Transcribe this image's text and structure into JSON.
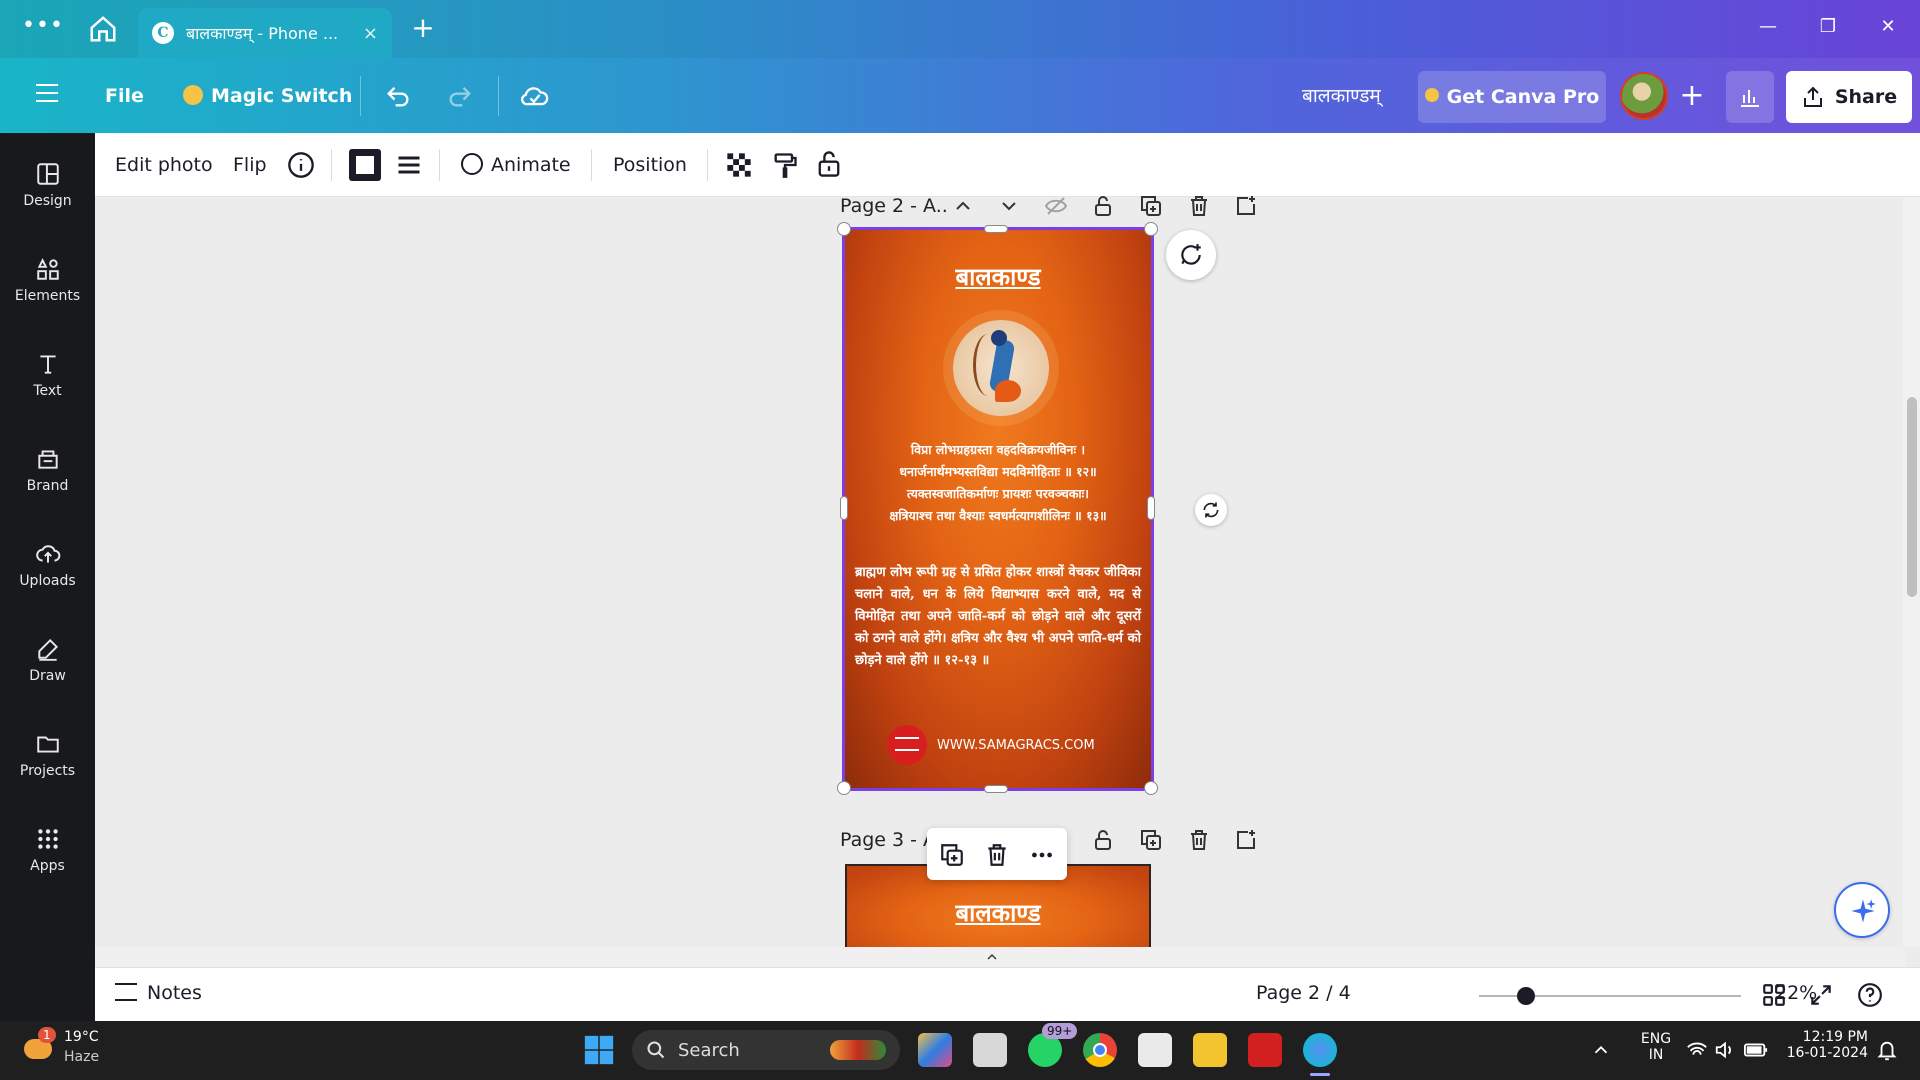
{
  "browser": {
    "tab_title": "बालकाण्डम् - Phone ...",
    "tab_logo": "C",
    "tab_close": "×",
    "new_tab": "+",
    "menu_dots": "•••",
    "window_minimize": "—",
    "window_restore": "❐",
    "window_close": "✕"
  },
  "header": {
    "file_label": "File",
    "magic_switch_label": "Magic Switch",
    "design_title": "बालकाण्डम्",
    "get_pro_label": "Get Canva Pro",
    "add_label": "+",
    "share_label": "Share"
  },
  "sidebar": {
    "items": [
      {
        "label": "Design"
      },
      {
        "label": "Elements"
      },
      {
        "label": "Text"
      },
      {
        "label": "Brand"
      },
      {
        "label": "Uploads"
      },
      {
        "label": "Draw"
      },
      {
        "label": "Projects"
      },
      {
        "label": "Apps"
      }
    ]
  },
  "toolbar": {
    "edit_photo": "Edit photo",
    "flip": "Flip",
    "animate": "Animate",
    "position": "Position"
  },
  "page2": {
    "label": "Page 2 - A..",
    "title": "बालकाण्ड",
    "shloka_lines": [
      "विप्रा लोभग्रहग्रस्ता वहदविक्रयजीविनः ।",
      "धनार्जनार्थमभ्यस्तविद्या मदविमोहिताः ॥ १२॥",
      "त्यक्तस्वजातिकर्माणः प्रायशः परवञ्चकाः।",
      "क्षत्रियाश्च तथा वैश्याः स्वधर्मत्यागशीलिनः ॥ १३॥"
    ],
    "hindi_text": "ब्राह्मण लोभ रूपी ग्रह से ग्रसित होकर शास्त्रों वेचकर जीविका चलाने वाले, धन के लिये विद्याभ्यास करने वाले, मद से विमोहित तथा अपने जाति-कर्म को छोड़ने वाले और दूसरों को ठगने वाले होंगे। क्षत्रिय और वैश्य भी अपने जाति-धर्म को छोड़ने वाले होंगे ॥ १२-१३ ॥",
    "website": "WWW.SAMAGRACS.COM"
  },
  "page3": {
    "label": "Page 3 - A",
    "title": "बालकाण्ड"
  },
  "footer": {
    "notes_label": "Notes",
    "page_indicator": "Page 2 / 4",
    "zoom": "22%",
    "zoom_level_fraction": 0.18
  },
  "taskbar": {
    "weather_temp": "19°C",
    "weather_desc": "Haze",
    "weather_badge": "1",
    "search_label": "Search",
    "whatsapp_badge": "99+",
    "lang_top": "ENG",
    "lang_bottom": "IN",
    "time": "12:19 PM",
    "date": "16-01-2024"
  },
  "colors": {
    "accent_purple": "#7b3fe4",
    "header_start": "#19b5c8",
    "header_end": "#7150dc",
    "sidebar_bg": "#18191b",
    "page_orange": "#e36414",
    "brand_red": "#d81e1e"
  }
}
